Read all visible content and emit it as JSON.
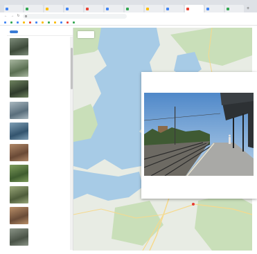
{
  "browser": {
    "tabs": [
      {
        "title": "",
        "color": "#4285f4",
        "active": false
      },
      {
        "title": "",
        "color": "#34a853",
        "active": false
      },
      {
        "title": "",
        "color": "#fbbc05",
        "active": false
      },
      {
        "title": "",
        "color": "#4285f4",
        "active": false
      },
      {
        "title": "",
        "color": "#ea4335",
        "active": false
      },
      {
        "title": "",
        "color": "#4285f4",
        "active": false
      },
      {
        "title": "",
        "color": "#34a853",
        "active": false
      },
      {
        "title": "",
        "color": "#fbbc05",
        "active": false
      },
      {
        "title": "",
        "color": "#4285f4",
        "active": false
      },
      {
        "title": "",
        "color": "#ea4335",
        "active": true
      },
      {
        "title": "",
        "color": "#4285f4",
        "active": false
      },
      {
        "title": "",
        "color": "#34a853",
        "active": false
      }
    ],
    "new_tab": "+",
    "url": "",
    "bookmarks": [
      {
        "label": "",
        "color": "#4285f4"
      },
      {
        "label": "",
        "color": "#34a853"
      },
      {
        "label": "",
        "color": "#4285f4"
      },
      {
        "label": "",
        "color": "#fbbc05"
      },
      {
        "label": "",
        "color": "#ea4335"
      },
      {
        "label": "",
        "color": "#4285f4"
      },
      {
        "label": "",
        "color": "#fbbc05"
      },
      {
        "label": "",
        "color": "#34a853"
      },
      {
        "label": "",
        "color": "#fbbc05"
      },
      {
        "label": "",
        "color": "#4285f4"
      },
      {
        "label": "",
        "color": "#ea4335"
      },
      {
        "label": "",
        "color": "#34a853"
      }
    ]
  },
  "sidebar": {
    "tabs": [
      {
        "label": "",
        "active": true
      },
      {
        "label": "",
        "active": false
      }
    ],
    "items": [
      {
        "title": "",
        "subtitle": "",
        "colors": [
          "#3d4a3a",
          "#7d8c7a"
        ]
      },
      {
        "title": "",
        "subtitle": "",
        "colors": [
          "#5a6f52",
          "#a8b7a0"
        ]
      },
      {
        "title": "",
        "subtitle": "",
        "colors": [
          "#2f3b2c",
          "#6f845f"
        ]
      },
      {
        "title": "",
        "subtitle": "",
        "colors": [
          "#596e7c",
          "#a9b8c0"
        ]
      },
      {
        "title": "",
        "subtitle": "",
        "colors": [
          "#33546e",
          "#7f9fb5"
        ]
      },
      {
        "title": "",
        "subtitle": "",
        "colors": [
          "#6a4a36",
          "#b08868"
        ]
      },
      {
        "title": "",
        "subtitle": "",
        "colors": [
          "#3f5d2f",
          "#7e9c5c"
        ]
      },
      {
        "title": "",
        "subtitle": "",
        "colors": [
          "#4f5d3b",
          "#99a779"
        ]
      },
      {
        "title": "",
        "subtitle": "",
        "colors": [
          "#6a4c38",
          "#b98f68"
        ]
      },
      {
        "title": "",
        "subtitle": "",
        "colors": [
          "#4a5347",
          "#8a9487"
        ]
      }
    ]
  },
  "map": {
    "view_toggle": [
      {
        "label": "",
        "active": true
      },
      {
        "label": "",
        "active": false
      }
    ],
    "place_labels": [
      "",
      "",
      "",
      "",
      "",
      ""
    ],
    "pin_label": "",
    "colors": {
      "water": "#a7cbe6",
      "land": "#e8ece4",
      "green": "#c9dfb9",
      "road": "#f6d98c"
    }
  },
  "popup": {
    "caption": "",
    "date": ""
  }
}
